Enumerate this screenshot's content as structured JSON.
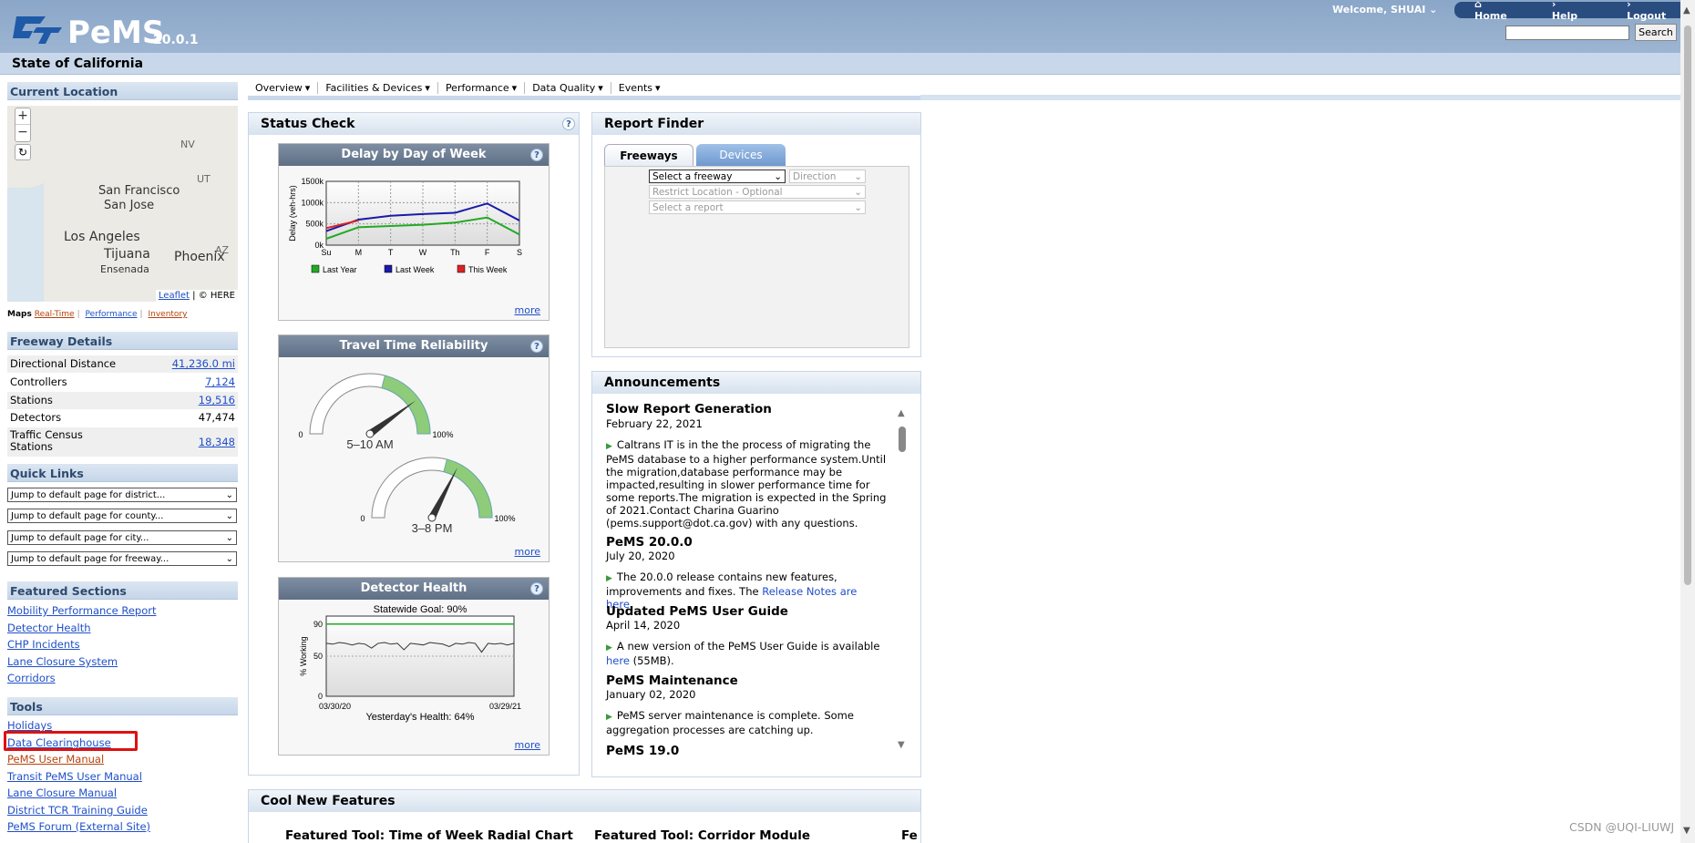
{
  "header": {
    "app_name": "PeMS",
    "version": "20.0.1",
    "welcome": "Welcome, SHUAI",
    "nav": [
      {
        "label": "Home"
      },
      {
        "label": "Help"
      },
      {
        "label": "Logout"
      }
    ],
    "search_button": "Search",
    "search_value": ""
  },
  "state_bar": "State of California",
  "sidebar": {
    "current_location": "Current Location",
    "map": {
      "cities": [
        "San Francisco",
        "San Jose",
        "Los Angeles",
        "Tijuana",
        "Ensenada",
        "Phoenix"
      ],
      "states": [
        "NV",
        "UT",
        "AZ"
      ],
      "attribution_link": "Leaflet",
      "attribution_rest": "| © HERE",
      "zoom_in": "+",
      "zoom_out": "−",
      "modes_label": "Maps",
      "modes": [
        "Real-Time",
        "Performance",
        "Inventory"
      ]
    },
    "freeway_details": {
      "title": "Freeway Details",
      "rows": [
        {
          "label": "Directional Distance",
          "value": "41,236.0 mi",
          "link": true
        },
        {
          "label": "Controllers",
          "value": "7,124",
          "link": true
        },
        {
          "label": "Stations",
          "value": "19,516",
          "link": true
        },
        {
          "label": "Detectors",
          "value": "47,474",
          "link": false
        },
        {
          "label": "Traffic Census Stations",
          "value": "18,348",
          "link": true
        }
      ]
    },
    "quick_links": {
      "title": "Quick Links",
      "selects": [
        "Jump to default page for district...",
        "Jump to default page for county...",
        "Jump to default page for city...",
        "Jump to default page for freeway..."
      ]
    },
    "featured_sections": {
      "title": "Featured Sections",
      "links": [
        "Mobility Performance Report",
        "Detector Health",
        "CHP Incidents",
        "Lane Closure System",
        "Corridors"
      ]
    },
    "tools": {
      "title": "Tools",
      "links": [
        "Holidays",
        "Data Clearinghouse",
        "PeMS User Manual",
        "Transit PeMS User Manual",
        "Lane Closure Manual",
        "District TCR Training Guide",
        "PeMS Forum (External Site)"
      ]
    }
  },
  "main_nav": [
    "Overview",
    "Facilities & Devices",
    "Performance",
    "Data Quality",
    "Events"
  ],
  "status_check": {
    "title": "Status Check",
    "help": "?",
    "more": "more",
    "delay": {
      "title": "Delay by Day of Week",
      "ylabel": "Delay (veh-hrs)",
      "yticks": [
        "1500k",
        "1000k",
        "500k",
        "0k"
      ],
      "days": [
        "Su",
        "M",
        "T",
        "W",
        "Th",
        "F",
        "S"
      ],
      "legend": [
        "Last Year",
        "Last Week",
        "This Week"
      ]
    },
    "ttr": {
      "title": "Travel Time Reliability",
      "gauge1": {
        "label": "5–10 AM",
        "min": "0",
        "max": "100%",
        "needle_pct": 80
      },
      "gauge2": {
        "label": "3–8 PM",
        "min": "0",
        "max": "100%",
        "needle_pct": 65
      }
    },
    "health": {
      "title": "Detector Health",
      "goal": "Statewide Goal: 90%",
      "ylabel": "% Working",
      "yticks": [
        "90",
        "50",
        "0"
      ],
      "x_start": "03/30/20",
      "x_end": "03/29/21",
      "footer": "Yesterday's Health: 64%"
    }
  },
  "report_finder": {
    "title": "Report Finder",
    "tabs": [
      "Freeways",
      "Devices"
    ],
    "freeway_select": "Select a freeway",
    "direction_select": "Direction",
    "location_select": "Restrict Location - Optional",
    "report_select": "Select a report"
  },
  "announcements": {
    "title": "Announcements",
    "items": [
      {
        "title": "Slow Report Generation",
        "date": "February 22, 2021",
        "body": "Caltrans IT is in the the process of migrating the PeMS database to a higher performance system.Until the migration,database performance may be impacted,resulting in slower performance time for some reports.The migration is expected in the Spring of 2021.Contact Charina Guarino (pems.support@dot.ca.gov) with any questions."
      },
      {
        "title": "PeMS 20.0.0",
        "date": "July 20, 2020",
        "body_pre": "The 20.0.0 release contains new features, improvements and fixes. The ",
        "body_link": "Release Notes are here",
        "body_post": "."
      },
      {
        "title": "Updated PeMS User Guide",
        "date": "April 14, 2020",
        "body_pre": "A new version of the PeMS User Guide is available ",
        "body_link": "here",
        "body_post": " (55MB)."
      },
      {
        "title": "PeMS Maintenance",
        "date": "January 02, 2020",
        "body": "PeMS server maintenance is complete. Some aggregation processes are catching up."
      },
      {
        "title": "PeMS 19.0"
      }
    ]
  },
  "cool_features": {
    "title": "Cool New Features",
    "items": [
      "Featured Tool: Time of Week Radial Chart",
      "Featured Tool: Corridor Module",
      "Fe"
    ]
  },
  "watermark": "CSDN @UQI-LIUWJ",
  "chart_data": [
    {
      "type": "line",
      "title": "Delay by Day of Week",
      "ylabel": "Delay (veh-hrs)",
      "categories": [
        "Su",
        "M",
        "T",
        "W",
        "Th",
        "F",
        "S"
      ],
      "ylim": [
        0,
        1500000
      ],
      "series": [
        {
          "name": "Last Year",
          "color": "#22aa22",
          "values": [
            150000,
            420000,
            450000,
            480000,
            530000,
            650000,
            250000
          ]
        },
        {
          "name": "Last Week",
          "color": "#1a1aaa",
          "values": [
            330000,
            600000,
            690000,
            730000,
            760000,
            980000,
            580000
          ]
        },
        {
          "name": "This Week",
          "color": "#dd2222",
          "values": [
            400000,
            580000
          ]
        }
      ]
    },
    {
      "type": "line",
      "title": "Detector Health",
      "ylabel": "% Working",
      "ylim": [
        0,
        100
      ],
      "goal": 90,
      "x_range": [
        "03/30/20",
        "03/29/21"
      ],
      "series": [
        {
          "name": "% Working",
          "color": "#333333",
          "values": [
            66,
            65,
            67,
            66,
            64,
            66,
            65,
            60,
            66,
            67,
            65,
            66,
            58,
            66,
            65,
            64,
            67,
            66,
            65,
            62,
            66,
            65,
            67,
            66,
            55,
            66,
            65,
            66,
            64,
            66
          ]
        }
      ]
    }
  ]
}
